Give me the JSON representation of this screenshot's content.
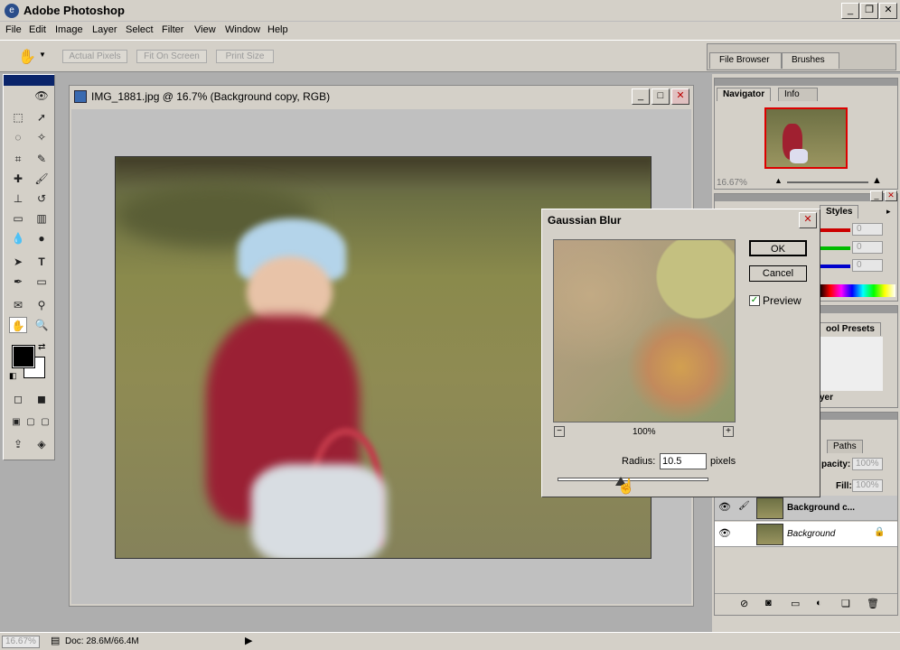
{
  "app": {
    "title": "Adobe Photoshop"
  },
  "menu": [
    "File",
    "Edit",
    "Image",
    "Layer",
    "Select",
    "Filter",
    "View",
    "Window",
    "Help"
  ],
  "options": {
    "actual_pixels": "Actual Pixels",
    "fit_on_screen": "Fit On Screen",
    "print_size": "Print Size",
    "tab_file_browser": "File Browser",
    "tab_brushes": "Brushes"
  },
  "document": {
    "title": "IMG_1881.jpg @ 16.7% (Background copy, RGB)"
  },
  "navigator": {
    "tab_navigator": "Navigator",
    "tab_info": "Info",
    "zoom": "16.67%"
  },
  "panels": {
    "styles_tab": "Styles",
    "tool_presets_tab": "ool Presets",
    "layer_label": "yer",
    "paths_tab": "Paths",
    "opacity_label": "pacity:",
    "opacity_value": "100%",
    "fill_label": "Fill:",
    "fill_value": "100%",
    "color_value": "0"
  },
  "layers": [
    {
      "name": "Background c...",
      "bold": true
    },
    {
      "name": "Background",
      "italic": true
    }
  ],
  "dialog": {
    "title": "Gaussian Blur",
    "ok": "OK",
    "cancel": "Cancel",
    "preview_label": "Preview",
    "preview_checked": true,
    "zoom": "100%",
    "radius_label": "Radius:",
    "radius_value": "10.5",
    "units": "pixels",
    "slider_fraction": 0.42
  },
  "status": {
    "zoom": "16.67%",
    "doc": "Doc: 28.6M/66.4M"
  },
  "colors": {
    "red": "#cc0000",
    "green": "#00bb00",
    "blue": "#0000cc"
  }
}
